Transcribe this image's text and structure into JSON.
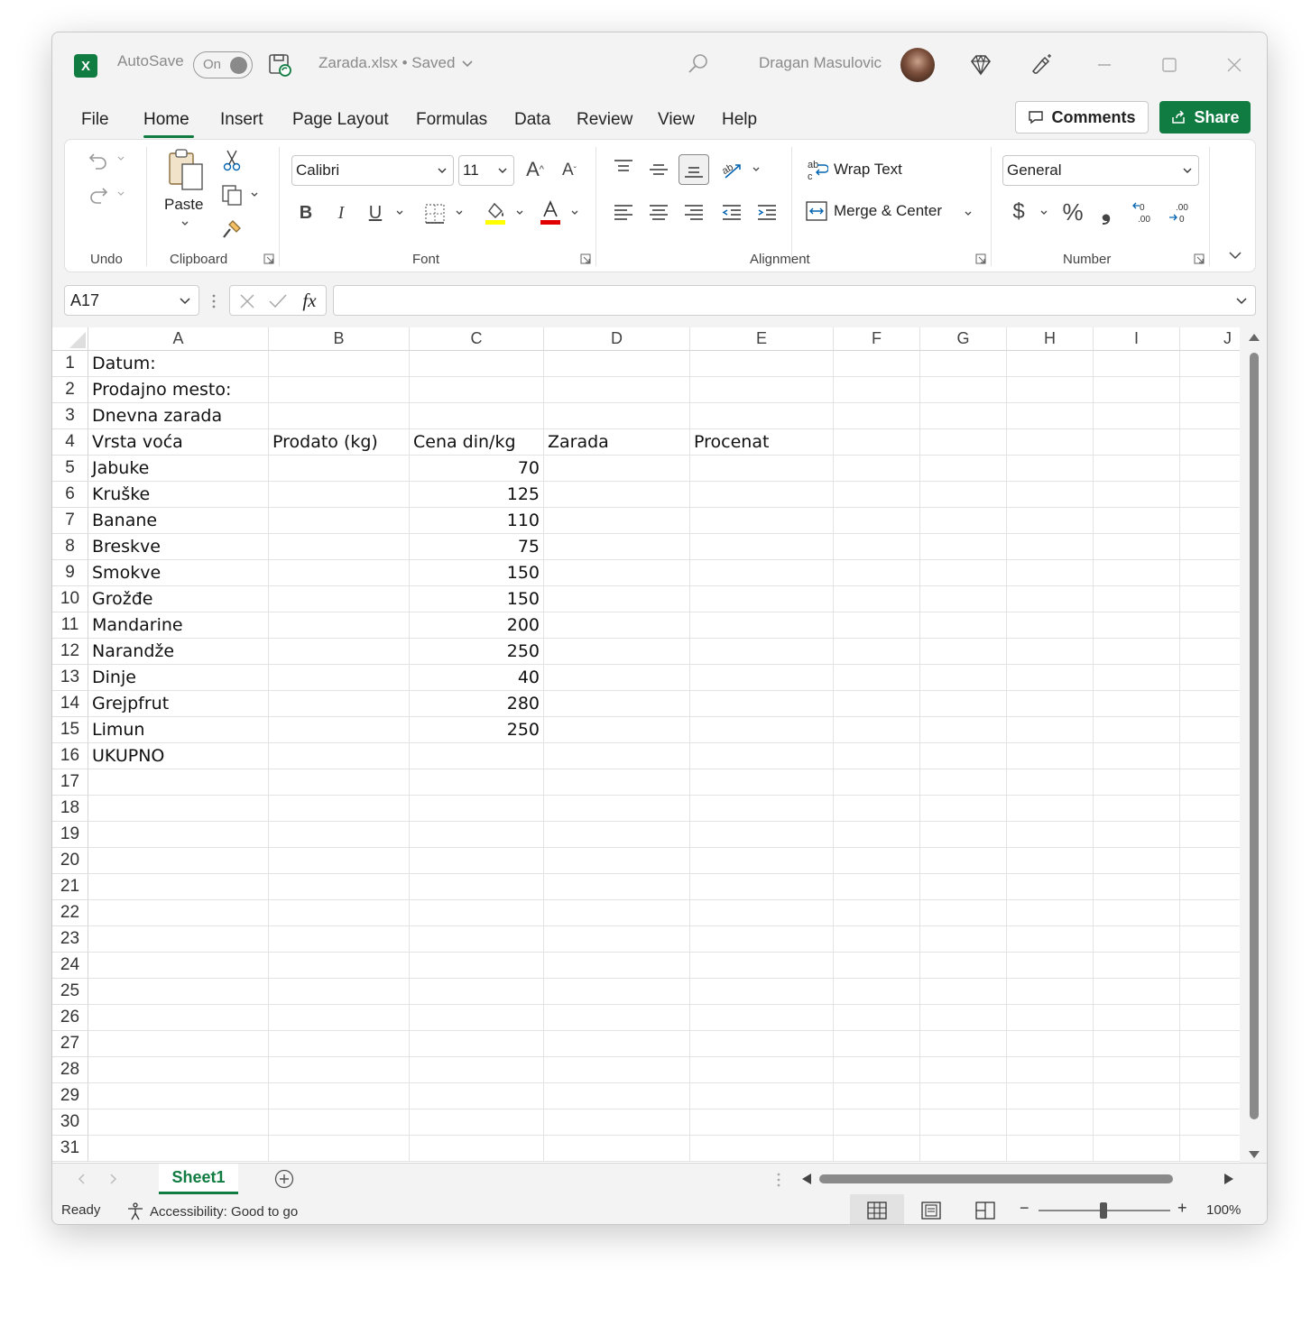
{
  "titlebar": {
    "app_icon": "excel-logo",
    "autosave_label": "AutoSave",
    "autosave_state": "On",
    "document": "Zarada.xlsx • Saved",
    "user_name": "Dragan Masulovic"
  },
  "menu": {
    "tabs": [
      "File",
      "Home",
      "Insert",
      "Page Layout",
      "Formulas",
      "Data",
      "Review",
      "View",
      "Help"
    ],
    "active_tab": "Home",
    "comments_label": "Comments",
    "share_label": "Share"
  },
  "ribbon": {
    "undo_label": "Undo",
    "paste_label": "Paste",
    "clipboard_label": "Clipboard",
    "font_name": "Calibri",
    "font_size": "11",
    "font_label": "Font",
    "bold": "B",
    "italic": "I",
    "underline": "U",
    "wrap_text": "Wrap Text",
    "merge_center": "Merge & Center",
    "alignment_label": "Alignment",
    "number_format": "General",
    "number_label": "Number",
    "currency": "$",
    "percent": "%",
    "comma": "❟"
  },
  "formula_bar": {
    "name_box": "A17",
    "fx": "fx",
    "formula": ""
  },
  "sheet": {
    "columns": [
      "A",
      "B",
      "C",
      "D",
      "E",
      "F",
      "G",
      "H",
      "I",
      "J"
    ],
    "row_numbers": [
      "1",
      "2",
      "3",
      "4",
      "5",
      "6",
      "7",
      "8",
      "9",
      "10",
      "11",
      "12",
      "13",
      "14",
      "15",
      "16",
      "17",
      "18",
      "19",
      "20",
      "21",
      "22",
      "23",
      "24",
      "25",
      "26",
      "27",
      "28",
      "29",
      "30",
      "31"
    ],
    "cells": [
      {
        "row": 1,
        "col": "A",
        "value": "Datum:"
      },
      {
        "row": 2,
        "col": "A",
        "value": "Prodajno mesto:"
      },
      {
        "row": 3,
        "col": "A",
        "value": "Dnevna zarada"
      },
      {
        "row": 4,
        "col": "A",
        "value": "Vrsta voća"
      },
      {
        "row": 4,
        "col": "B",
        "value": "Prodato (kg)"
      },
      {
        "row": 4,
        "col": "C",
        "value": "Cena din/kg"
      },
      {
        "row": 4,
        "col": "D",
        "value": "Zarada"
      },
      {
        "row": 4,
        "col": "E",
        "value": "Procenat"
      },
      {
        "row": 5,
        "col": "A",
        "value": "Jabuke"
      },
      {
        "row": 5,
        "col": "C",
        "value": "70",
        "numeric": true
      },
      {
        "row": 6,
        "col": "A",
        "value": "Kruške"
      },
      {
        "row": 6,
        "col": "C",
        "value": "125",
        "numeric": true
      },
      {
        "row": 7,
        "col": "A",
        "value": "Banane"
      },
      {
        "row": 7,
        "col": "C",
        "value": "110",
        "numeric": true
      },
      {
        "row": 8,
        "col": "A",
        "value": "Breskve"
      },
      {
        "row": 8,
        "col": "C",
        "value": "75",
        "numeric": true
      },
      {
        "row": 9,
        "col": "A",
        "value": "Smokve"
      },
      {
        "row": 9,
        "col": "C",
        "value": "150",
        "numeric": true
      },
      {
        "row": 10,
        "col": "A",
        "value": "Grožđe"
      },
      {
        "row": 10,
        "col": "C",
        "value": "150",
        "numeric": true
      },
      {
        "row": 11,
        "col": "A",
        "value": "Mandarine"
      },
      {
        "row": 11,
        "col": "C",
        "value": "200",
        "numeric": true
      },
      {
        "row": 12,
        "col": "A",
        "value": "Narandže"
      },
      {
        "row": 12,
        "col": "C",
        "value": "250",
        "numeric": true
      },
      {
        "row": 13,
        "col": "A",
        "value": "Dinje"
      },
      {
        "row": 13,
        "col": "C",
        "value": "40",
        "numeric": true
      },
      {
        "row": 14,
        "col": "A",
        "value": "Grejpfrut"
      },
      {
        "row": 14,
        "col": "C",
        "value": "280",
        "numeric": true
      },
      {
        "row": 15,
        "col": "A",
        "value": "Limun"
      },
      {
        "row": 15,
        "col": "C",
        "value": "250",
        "numeric": true
      },
      {
        "row": 16,
        "col": "A",
        "value": "UKUPNO"
      }
    ],
    "selected_cell": "A17"
  },
  "sheetbar": {
    "active_sheet": "Sheet1"
  },
  "statusbar": {
    "status": "Ready",
    "accessibility": "Accessibility: Good to go",
    "zoom_minus": "−",
    "zoom_plus": "+",
    "zoom": "100%"
  },
  "colors": {
    "accent": "#107c41"
  }
}
